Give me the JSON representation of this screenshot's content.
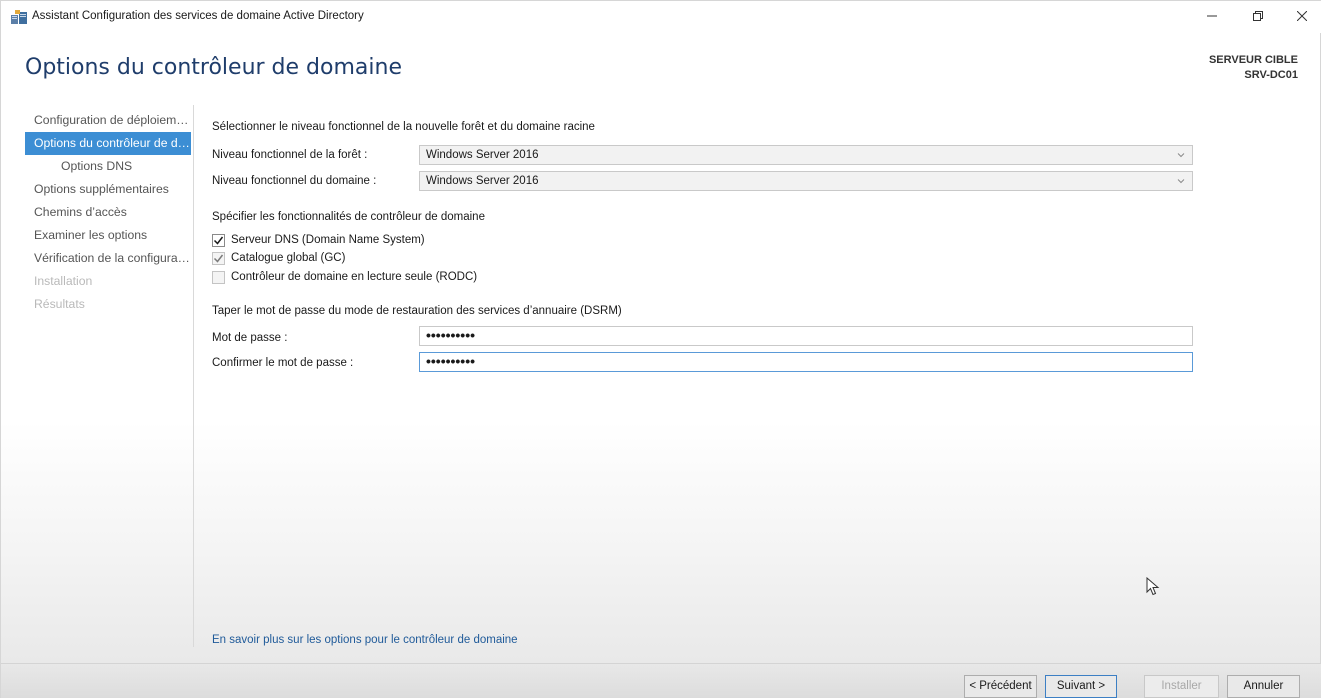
{
  "window": {
    "title": "Assistant Configuration des services de domaine Active Directory",
    "minimize": "—",
    "maximize": "🗗",
    "close": "✕"
  },
  "page_title": "Options du contrôleur de domaine",
  "target_server": {
    "label": "SERVEUR CIBLE",
    "name": "SRV-DC01"
  },
  "nav": {
    "items": [
      {
        "label": "Configuration de déploiement"
      },
      {
        "label": "Options du contrôleur de domaine"
      },
      {
        "label": "Options DNS"
      },
      {
        "label": "Options supplémentaires"
      },
      {
        "label": "Chemins d’accès"
      },
      {
        "label": "Examiner les options"
      },
      {
        "label": "Vérification de la configuration"
      },
      {
        "label": "Installation"
      },
      {
        "label": "Résultats"
      }
    ]
  },
  "functional_level": {
    "heading": "Sélectionner le niveau fonctionnel de la nouvelle forêt et du domaine racine",
    "forest_label": "Niveau fonctionnel de la forêt :",
    "forest_value": "Windows Server 2016",
    "domain_label": "Niveau fonctionnel du domaine :",
    "domain_value": "Windows Server 2016"
  },
  "capabilities": {
    "heading": "Spécifier les fonctionnalités de contrôleur de domaine",
    "dns": {
      "label": "Serveur DNS (Domain Name System)",
      "checked": true
    },
    "gc": {
      "label": "Catalogue global (GC)",
      "checked": true
    },
    "rodc": {
      "label": "Contrôleur de domaine en lecture seule (RODC)",
      "checked": false
    }
  },
  "dsrm": {
    "heading": "Taper le mot de passe du mode de restauration des services d’annuaire (DSRM)",
    "password_label": "Mot de passe :",
    "password_value": "••••••••••",
    "confirm_label": "Confirmer le mot de passe :",
    "confirm_value": "••••••••••"
  },
  "learn_more": "En savoir plus sur les options pour le contrôleur de domaine",
  "buttons": {
    "previous": "< Précédent",
    "next": "Suivant >",
    "install": "Installer",
    "cancel": "Annuler"
  }
}
